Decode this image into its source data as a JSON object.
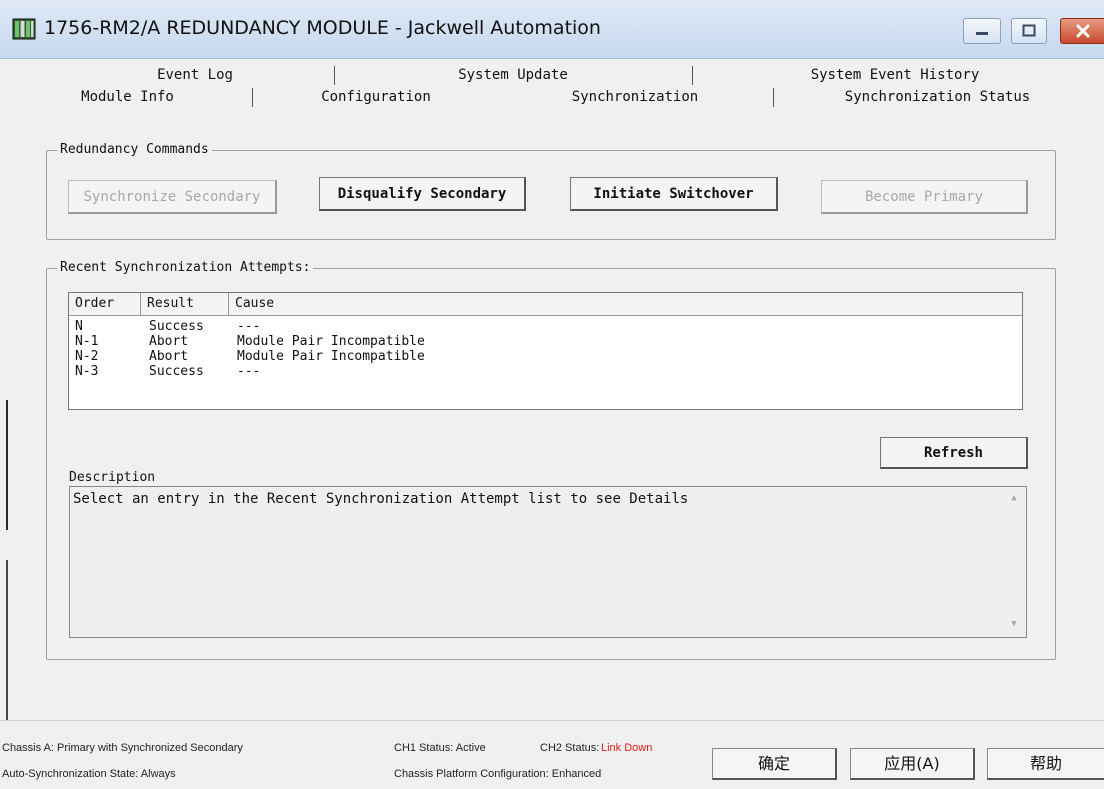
{
  "window": {
    "title": "1756-RM2/A REDUNDANCY MODULE - Jackwell Automation",
    "icon": "module-grid-icon",
    "controls": [
      "minimize-icon",
      "maximize-icon",
      "close-icon"
    ]
  },
  "tabs": {
    "row1": [
      "Event Log",
      "System Update",
      "System Event History"
    ],
    "row2": [
      "Module Info",
      "Configuration",
      "Synchronization",
      "Synchronization Status"
    ],
    "active": "Synchronization"
  },
  "commands": {
    "title": "Redundancy Commands",
    "buttons": [
      {
        "label": "Synchronize Secondary",
        "enabled": false
      },
      {
        "label": "Disqualify Secondary",
        "enabled": true
      },
      {
        "label": "Initiate Switchover",
        "enabled": true
      },
      {
        "label": "Become Primary",
        "enabled": false
      }
    ]
  },
  "attempts": {
    "title": "Recent Synchronization Attempts:",
    "columns": [
      "Order",
      "Result",
      "Cause"
    ],
    "rows": [
      {
        "order": "N",
        "result": "Success",
        "cause": "---"
      },
      {
        "order": "N-1",
        "result": "Abort",
        "cause": "Module Pair Incompatible"
      },
      {
        "order": "N-2",
        "result": "Abort",
        "cause": "Module Pair Incompatible"
      },
      {
        "order": "N-3",
        "result": "Success",
        "cause": "---"
      }
    ],
    "refresh_label": "Refresh"
  },
  "description": {
    "label": "Description",
    "text": "Select an entry in the Recent Synchronization Attempt list to see Details"
  },
  "status": {
    "chassis_a": "Chassis A: Primary with Synchronized Secondary",
    "ch1": "CH1 Status: Active",
    "ch2_label": "CH2 Status:",
    "ch2_value": "Link Down",
    "ch2_color": "#e21c1c",
    "auto_sync": "Auto-Synchronization State:  Always",
    "platform": "Chassis Platform Configuration:  Enhanced"
  },
  "footer": {
    "ok": "确定",
    "apply": "应用(A)",
    "help": "帮助"
  }
}
